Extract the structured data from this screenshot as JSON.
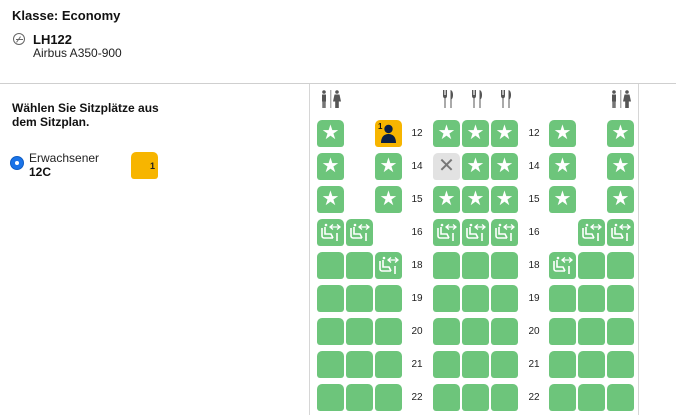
{
  "header": {
    "class_label": "Klasse: Economy",
    "flight_number": "LH122",
    "aircraft": "Airbus A350-900"
  },
  "left": {
    "instruction": "Wählen Sie Sitzplätze aus dem Sitzplan.",
    "passenger": {
      "type": "Erwachsener",
      "seat": "12C",
      "badge": "1"
    }
  },
  "seatmap": {
    "facilities": [
      {
        "icon": "lavatory-icon"
      },
      {
        "icon": "galley-icon"
      },
      {
        "icon": "galley-icon"
      },
      {
        "icon": "galley-icon"
      },
      {
        "icon": "lavatory-icon"
      }
    ],
    "colors": {
      "available": "#6dc57b",
      "unavailable": "#e2e2e2",
      "selected": "#f7b500"
    },
    "selected_badge": "1",
    "rows": [
      {
        "number": "12",
        "seats": [
          "star",
          null,
          "selected",
          "star",
          "star",
          "star",
          "star",
          null,
          "star"
        ]
      },
      {
        "number": "14",
        "seats": [
          "star",
          null,
          "star",
          "blocked",
          "star",
          "star",
          "star",
          null,
          "star"
        ]
      },
      {
        "number": "15",
        "seats": [
          "star",
          null,
          "star",
          "star",
          "star",
          "star",
          "star",
          null,
          "star"
        ]
      },
      {
        "number": "16",
        "seats": [
          "legroom",
          "legroom",
          null,
          "legroom",
          "legroom",
          "legroom",
          null,
          "legroom",
          "legroom"
        ]
      },
      {
        "number": "18",
        "seats": [
          "plain",
          "plain",
          "legroom",
          "plain",
          "plain",
          "plain",
          "legroom",
          "plain",
          "plain"
        ]
      },
      {
        "number": "19",
        "seats": [
          "plain",
          "plain",
          "plain",
          "plain",
          "plain",
          "plain",
          "plain",
          "plain",
          "plain"
        ]
      },
      {
        "number": "20",
        "seats": [
          "plain",
          "plain",
          "plain",
          "plain",
          "plain",
          "plain",
          "plain",
          "plain",
          "plain"
        ]
      },
      {
        "number": "21",
        "seats": [
          "plain",
          "plain",
          "plain",
          "plain",
          "plain",
          "plain",
          "plain",
          "plain",
          "plain"
        ]
      },
      {
        "number": "22",
        "seats": [
          "plain",
          "plain",
          "plain",
          "plain",
          "plain",
          "plain",
          "plain",
          "plain",
          "plain"
        ]
      }
    ]
  }
}
